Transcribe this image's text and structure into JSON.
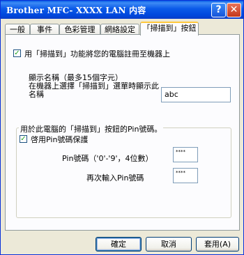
{
  "window": {
    "title": "Brother MFC- XXXX   LAN 内容"
  },
  "titlebar_buttons": {
    "help": "?",
    "close": "✕"
  },
  "tabs": [
    {
      "label": "一般"
    },
    {
      "label": "事件"
    },
    {
      "label": "色彩管理"
    },
    {
      "label": "網絡設定"
    },
    {
      "label": "「掃描到」按鈕",
      "active": true
    }
  ],
  "register": {
    "checked": true,
    "label": "用「掃描到」功能將您的電腦註冊至機器上"
  },
  "display_name": {
    "line1": "顯示名稱（最多15個字元）",
    "line2": "在機器上選擇「掃描到」選單時顯示此",
    "line3": "名稱",
    "value": "abc"
  },
  "pin_group": {
    "legend": "用於此電腦的「掃描到」按鈕的Pin號碼。",
    "enable_label": "啓用Pin號碼保護",
    "enable_checked": true,
    "pin_label": "Pin號碼（'0'-'9'，4位數）",
    "pin_value": "****",
    "repeat_label": "再次輸入Pin號碼",
    "repeat_value": "****"
  },
  "buttons": {
    "ok": "確定",
    "cancel": "取消",
    "apply": "套用(A)"
  }
}
